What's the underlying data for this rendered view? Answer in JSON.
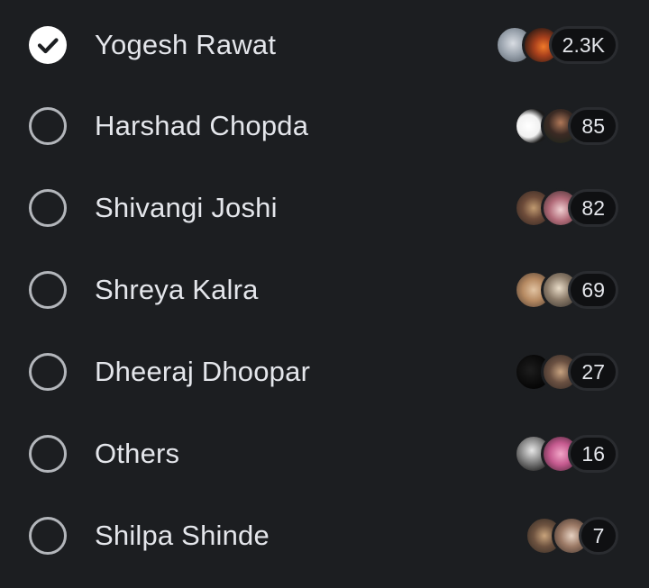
{
  "poll": {
    "options": [
      {
        "label": "Yogesh Rawat",
        "count": "2.3K",
        "selected": true,
        "avatars": [
          {
            "name": "avatar",
            "bg": "radial-gradient(circle at 45% 45%, #d9dde3 0%, #9aa3ad 45%, #4c5560 100%)"
          },
          {
            "name": "avatar",
            "bg": "radial-gradient(circle at 55% 55%, #f07a2a 0%, #a8401c 35%, #2b1a14 80%)"
          }
        ]
      },
      {
        "label": "Harshad Chopda",
        "count": "85",
        "selected": false,
        "avatars": [
          {
            "name": "avatar",
            "bg": "radial-gradient(circle at 35% 50%, #ffffff 0%, #f1f1f1 40%, #1b1b1b 65%)"
          },
          {
            "name": "avatar",
            "bg": "radial-gradient(circle at 50% 40%, #b07858 0%, #3b2a24 45%, #16241a 100%)"
          }
        ]
      },
      {
        "label": "Shivangi Joshi",
        "count": "82",
        "selected": false,
        "avatars": [
          {
            "name": "avatar",
            "bg": "radial-gradient(circle at 50% 50%, #c09a70 0%, #6e4c3a 45%, #2e2420 100%)"
          },
          {
            "name": "avatar",
            "bg": "radial-gradient(circle at 50% 55%, #f0d0d2 0%, #b16a78 45%, #3a2a2a 100%)"
          }
        ]
      },
      {
        "label": "Shreya Kalra",
        "count": "69",
        "selected": false,
        "avatars": [
          {
            "name": "avatar",
            "bg": "radial-gradient(circle at 50% 50%, #e1c3a2 0%, #b68a62 45%, #4b3a30 100%)"
          },
          {
            "name": "avatar",
            "bg": "radial-gradient(circle at 45% 45%, #e9dcc8 0%, #8a7a68 45%, #2d2a27 100%)"
          }
        ]
      },
      {
        "label": "Dheeraj Dhoopar",
        "count": "27",
        "selected": false,
        "avatars": [
          {
            "name": "avatar",
            "bg": "radial-gradient(circle at 40% 45%, #1d1d1d 0%, #080808 60%, #000000 100%)"
          },
          {
            "name": "avatar",
            "bg": "radial-gradient(circle at 50% 50%, #c7a380 0%, #6b5142 45%, #2f2723 100%)"
          }
        ]
      },
      {
        "label": "Others",
        "count": "16",
        "selected": false,
        "avatars": [
          {
            "name": "avatar",
            "bg": "radial-gradient(circle at 45% 40%, #e7e7e7 0%, #8a8a8a 40%, #1f1f1f 85%)"
          },
          {
            "name": "avatar",
            "bg": "radial-gradient(circle at 50% 50%, #f2a6c8 0%, #c55a8f 45%, #3a1f2c 100%)"
          }
        ]
      },
      {
        "label": "Shilpa Shinde",
        "count": "7",
        "selected": false,
        "avatars": [
          {
            "name": "avatar",
            "bg": "radial-gradient(circle at 50% 50%, #c9a47c 0%, #6e5340 45%, #2d2621 100%)"
          },
          {
            "name": "avatar",
            "bg": "radial-gradient(circle at 50% 50%, #e6d2c2 0%, #9c7a66 45%, #3c2f29 100%)"
          }
        ]
      }
    ]
  }
}
